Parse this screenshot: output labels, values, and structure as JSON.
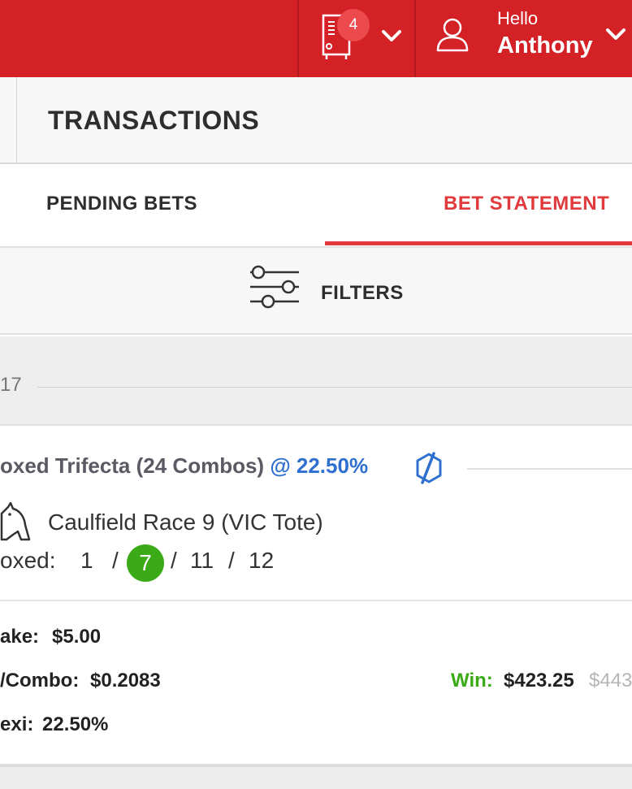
{
  "header": {
    "betslip_count": "4",
    "greeting": "Hello",
    "user_name": "Anthony"
  },
  "page_title": "TRANSACTIONS",
  "tabs": [
    {
      "label": "PENDING BETS",
      "active": false
    },
    {
      "label": "BET STATEMENT",
      "active": true
    }
  ],
  "filters": {
    "label": "FILTERS"
  },
  "date_group": {
    "label": "17"
  },
  "bet": {
    "title": "oxed Trifecta (24 Combos)",
    "odds_label": "@ 22.50%",
    "race": "Caulfield Race 9 (VIC Tote)",
    "selection_label": "oxed:",
    "runners": [
      "1",
      "7",
      "11",
      "12"
    ],
    "winning_runner": "7",
    "stake_label": "ake:",
    "stake_value": "$5.00",
    "combo_label": "/Combo:",
    "combo_value": "$0.2083",
    "flexi_label": "exi:",
    "flexi_value": "22.50%",
    "win_label": "Win:",
    "win_value": "$423.25",
    "win_original": "$443"
  },
  "colors": {
    "brand_red": "#d42126",
    "active_tab": "#e03a3c",
    "win_green": "#3aaa16",
    "link_blue": "#2e6fcf"
  },
  "icons": [
    "betslip-icon",
    "chevron-down-icon",
    "user-icon",
    "filter-sliders-icon",
    "boost-icon",
    "horse-icon"
  ]
}
